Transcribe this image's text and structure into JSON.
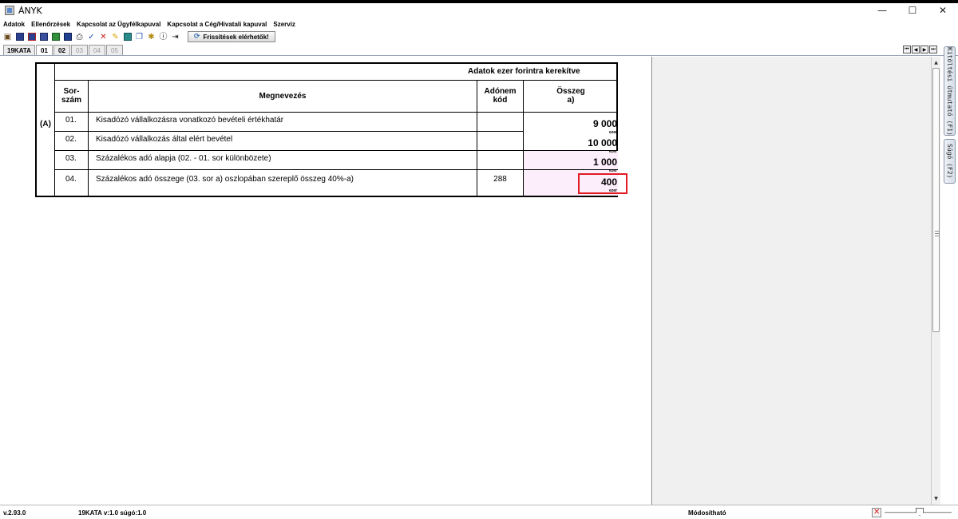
{
  "window": {
    "title": "ÁNYK",
    "minimize": "—",
    "maximize": "☐",
    "close": "✕"
  },
  "menu": [
    "Adatok",
    "Ellenőrzések",
    "Kapcsolat az Ügyfélkapuval",
    "Kapcsolat a Cég/Hivatali kapuval",
    "Szerviz"
  ],
  "toolbar": {
    "update_button": "Frissítések elérhetők!"
  },
  "tabs": [
    "19KATA",
    "01",
    "02",
    "03",
    "04",
    "05"
  ],
  "side_tabs": {
    "filling_tab": "Kitöltési útmutató (F1)",
    "help_tab": "Súgó (F2)"
  },
  "form": {
    "caption": "Adatok ezer forintra kerekítve",
    "section_label": "(A)",
    "headers": {
      "number": "Sor-\nszám",
      "name": "Megnevezés",
      "code": "Adónem\nkód",
      "amount": "Összeg\na)"
    },
    "rows": [
      {
        "num": "01.",
        "name": "Kisadózó vállalkozásra vonatkozó bevételi értékhatár",
        "code": "",
        "amount": "9 000",
        "unit": "ezer"
      },
      {
        "num": "02.",
        "name": "Kisadózó vállalkozás által elért bevétel",
        "code": "",
        "amount": "10 000",
        "unit": "ezer"
      },
      {
        "num": "03.",
        "name": "Százalékos adó alapja (02. - 01. sor különbözete)",
        "code": "",
        "amount": "1 000",
        "unit": "ezer"
      },
      {
        "num": "04.",
        "name": "Százalékos adó összege (03. sor a) oszlopában szereplő összeg 40%-a)",
        "code": "288",
        "amount": "400",
        "unit": "ezer"
      }
    ]
  },
  "status": {
    "version": "v.2.93.0",
    "form_info": "19KATA v:1.0 súgó:1.0",
    "mode": "Módosítható"
  },
  "colors": {
    "calculated_field": "#fceefa",
    "highlight": "#e21b23"
  }
}
